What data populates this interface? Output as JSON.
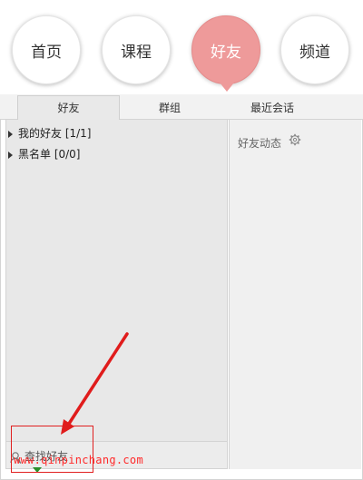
{
  "nav": {
    "items": [
      {
        "label": "首页"
      },
      {
        "label": "课程"
      },
      {
        "label": "好友"
      },
      {
        "label": "频道"
      }
    ]
  },
  "tabs": [
    {
      "label": "好友"
    },
    {
      "label": "群组"
    },
    {
      "label": "最近会话"
    }
  ],
  "friend_groups": [
    {
      "name": "我的好友 [1/1]"
    },
    {
      "name": "黑名单 [0/0]"
    }
  ],
  "feed": {
    "label": "好友动态",
    "icon": "gear-icon"
  },
  "search": {
    "label": "查找好友",
    "icon": "search-friend-icon"
  },
  "watermark": {
    "text": "www.qinpinchang.com"
  },
  "colors": {
    "active_nav": "#ee9a9a",
    "annotation": "#e02020",
    "pointer": "#2a8f2a"
  }
}
